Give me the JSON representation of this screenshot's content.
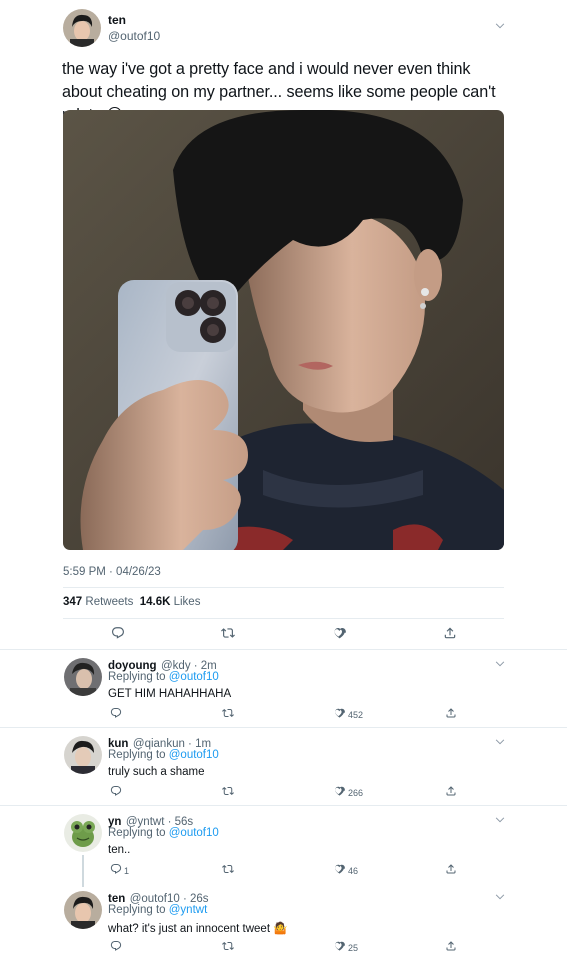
{
  "main_tweet": {
    "name": "ten",
    "handle": "@outof10",
    "text": "the way i've got a pretty face and i would never even think about cheating on my partner... seems like some people can't relate 😚",
    "timestamp": "5:59 PM · 04/26/23",
    "retweets_count": "347",
    "retweets_label": "Retweets",
    "likes_count": "14.6K",
    "likes_label": "Likes"
  },
  "replies": [
    {
      "name": "doyoung",
      "handle_time": "@kdy · 2m",
      "replying_prefix": "Replying to",
      "replying_to": "@outof10",
      "text": "GET HIM HAHAHHAHA",
      "replies_count": "",
      "likes_count": "452"
    },
    {
      "name": "kun",
      "handle_time": "@qiankun · 1m",
      "replying_prefix": "Replying to",
      "replying_to": "@outof10",
      "text": "truly such a shame",
      "replies_count": "",
      "likes_count": "266"
    },
    {
      "name": "yn",
      "handle_time": "@yntwt · 56s",
      "replying_prefix": "Replying to",
      "replying_to": "@outof10",
      "text": "ten..",
      "replies_count": "1",
      "likes_count": "46"
    },
    {
      "name": "ten",
      "handle_time": "@outof10 · 26s",
      "replying_prefix": "Replying to",
      "replying_to": "@yntwt",
      "text": "what? it's just an innocent tweet 🤷",
      "replies_count": "",
      "likes_count": "25"
    }
  ],
  "icons": {
    "reply": "reply-icon",
    "retweet": "retweet-icon",
    "like": "heart-icon",
    "share": "share-icon",
    "more": "chevron-down-icon"
  },
  "colors": {
    "link": "#1d9bf0",
    "secondary_text": "#536471",
    "divider": "#e6ecf0"
  }
}
